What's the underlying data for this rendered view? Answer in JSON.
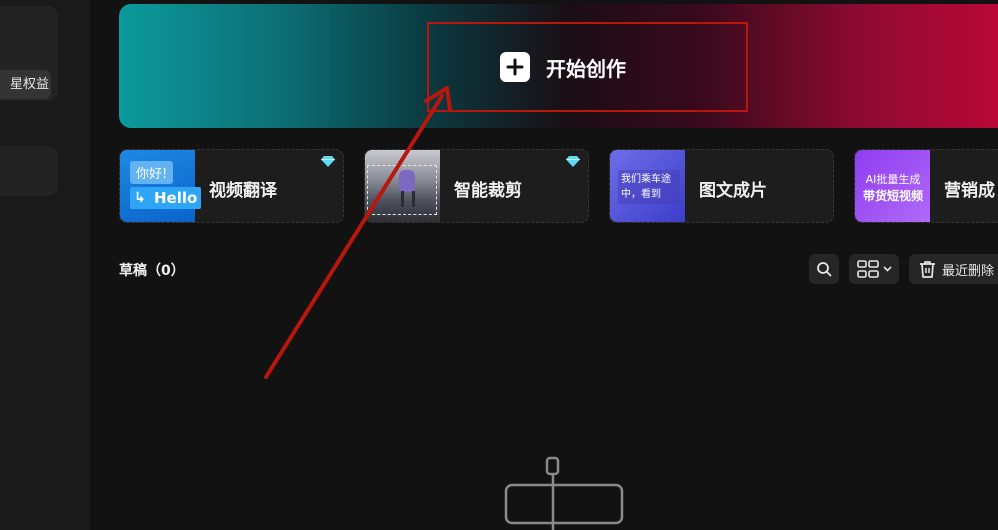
{
  "sidebar": {
    "benefit_pill": "星权益"
  },
  "banner": {
    "create_label": "开始创作"
  },
  "tools": [
    {
      "label": "视频翻译",
      "thumb_text_1": "你好!",
      "thumb_text_2": "Hello",
      "badge": "diamond-icon"
    },
    {
      "label": "智能裁剪",
      "badge": "diamond-icon"
    },
    {
      "label": "图文成片",
      "thumb_text": "我们乘车途中，看到"
    },
    {
      "label": "营销成",
      "thumb_text_1": "AI批量生成",
      "thumb_text_2": "带货短视频"
    }
  ],
  "drafts": {
    "title": "草稿（0）",
    "recent_delete_label": "最近删除"
  },
  "colors": {
    "highlight_box": "#b8170e",
    "annotation_arrow": "#b8170e",
    "background": "#121212"
  }
}
